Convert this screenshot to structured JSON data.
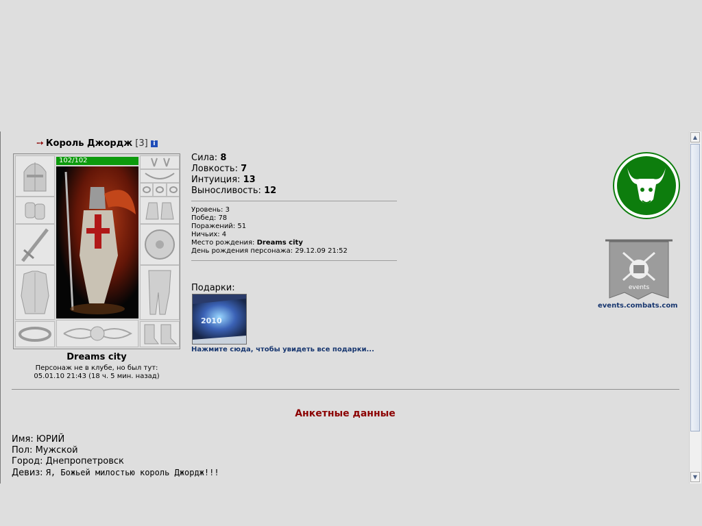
{
  "character": {
    "name": "Король Джордж",
    "level": "[3]",
    "info_icon": "i",
    "hp": "102/102",
    "city": "Dreams city",
    "status_line1": "Персонаж не в клубе, но был тут:",
    "status_line2": "05.01.10 21:43 (18 ч. 5 мин. назад)"
  },
  "stats": [
    {
      "label": "Сила:",
      "value": "8"
    },
    {
      "label": "Ловкость:",
      "value": "7"
    },
    {
      "label": "Интуиция:",
      "value": "13"
    },
    {
      "label": "Выносливость:",
      "value": "12"
    }
  ],
  "details": {
    "level_label": "Уровень:",
    "level": "3",
    "wins_label": "Побед:",
    "wins": "78",
    "losses_label": "Поражений:",
    "losses": "51",
    "draws_label": "Ничьих:",
    "draws": "4",
    "birthplace_label": "Место рождения:",
    "birthplace": "Dreams city",
    "birthday_label": "День рождения персонажа:",
    "birthday": "29.12.09 21:52"
  },
  "gifts": {
    "label": "Подарки:",
    "gift_year": "2010",
    "link": "Нажмите сюда, чтобы увидеть все подарки..."
  },
  "sidebar": {
    "events_banner_text": "events",
    "events_link": "events.combats.com"
  },
  "anketa": {
    "title": "Анкетные данные",
    "name_label": "Имя:",
    "name": "ЮРИЙ",
    "sex_label": "Пол:",
    "sex": "Мужской",
    "city_label": "Город:",
    "city": "Днепропетровск",
    "motto_label": "Девиз:",
    "motto": "Я, Божьей милостью король Джордж!!!"
  },
  "colors": {
    "accent_red": "#8b0000",
    "link_blue": "#17366f",
    "hp_green": "#0c9a0c",
    "clan_green": "#0d7d0d"
  },
  "icons": [
    "arrow-icon",
    "info-icon",
    "helmet-icon",
    "bracer-icon",
    "sword-icon",
    "armor-icon",
    "belt-icon",
    "earrings-icon",
    "necklace-icon",
    "rings-icon",
    "gloves-icon",
    "shield-icon",
    "greaves-icon",
    "boots-icon",
    "clan-bull-icon",
    "events-banner-icon",
    "scroll-up-icon",
    "scroll-down-icon"
  ]
}
